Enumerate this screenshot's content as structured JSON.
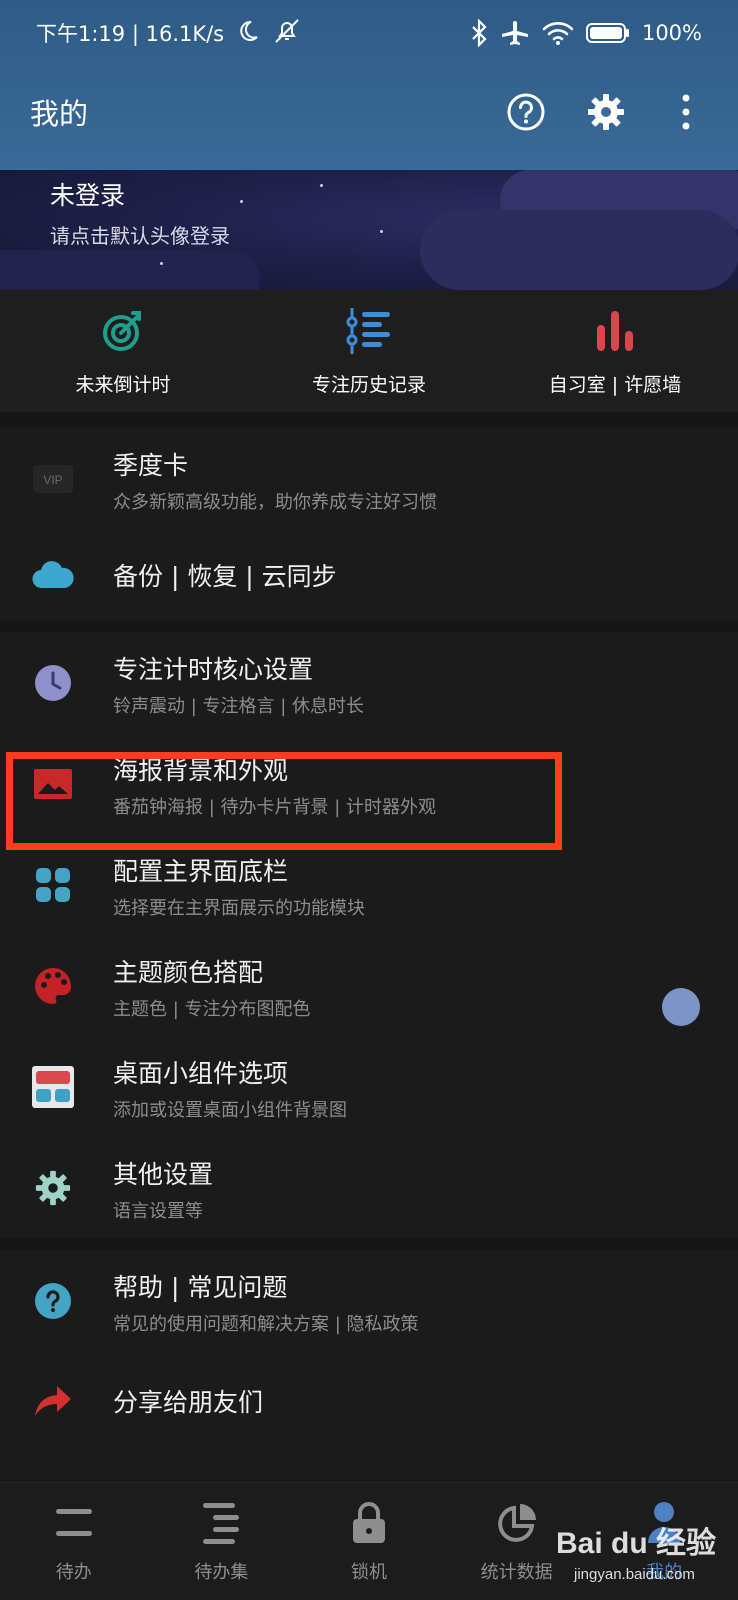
{
  "status_bar": {
    "time_speed": "下午1:19 | 16.1K/s",
    "battery": "100%"
  },
  "app_bar": {
    "title": "我的"
  },
  "profile": {
    "name": "未登录",
    "hint": "请点击默认头像登录"
  },
  "quick_actions": [
    {
      "label": "未来倒计时",
      "icon": "target-icon",
      "color": "#1e9e8c"
    },
    {
      "label": "专注历史记录",
      "icon": "timeline-list-icon",
      "color": "#3a8fd8"
    },
    {
      "label": "自习室 | 许愿墙",
      "icon": "bar-chart-icon",
      "color": "#d8474d"
    }
  ],
  "section1": [
    {
      "title": "季度卡",
      "subtitle": "众多新颖高级功能，助你养成专注好习惯",
      "icon": "vip-icon",
      "badge": "VIP"
    },
    {
      "title": "备份 | 恢复 | 云同步",
      "icon": "cloud-icon"
    }
  ],
  "section2": [
    {
      "title": "专注计时核心设置",
      "subtitle": "铃声震动 | 专注格言 | 休息时长",
      "icon": "clock-icon"
    },
    {
      "title": "海报背景和外观",
      "subtitle": "番茄钟海报 | 待办卡片背景 | 计时器外观",
      "icon": "image-icon"
    },
    {
      "title": "配置主界面底栏",
      "subtitle": "选择要在主界面展示的功能模块",
      "icon": "grid-icon"
    },
    {
      "title": "主题颜色搭配",
      "subtitle": "主题色 | 专注分布图配色",
      "icon": "palette-icon"
    },
    {
      "title": "桌面小组件选项",
      "subtitle": "添加或设置桌面小组件背景图",
      "icon": "widget-icon"
    },
    {
      "title": "其他设置",
      "subtitle": "语言设置等",
      "icon": "gear-icon"
    }
  ],
  "section3": [
    {
      "title": "帮助 | 常见问题",
      "subtitle": "常见的使用问题和解决方案 | 隐私政策",
      "icon": "help-icon"
    },
    {
      "title": "分享给朋友们",
      "icon": "share-icon"
    }
  ],
  "bottom_nav": [
    {
      "label": "待办",
      "icon": "todo-icon"
    },
    {
      "label": "待办集",
      "icon": "todo-set-icon"
    },
    {
      "label": "锁机",
      "icon": "lock-icon"
    },
    {
      "label": "统计数据",
      "icon": "pie-chart-icon"
    },
    {
      "label": "我的",
      "icon": "person-icon",
      "active": true
    }
  ],
  "watermark": {
    "brand": "Bai du 经验",
    "url": "jingyan.baidu.com"
  },
  "colors": {
    "header": "#3a6a98",
    "highlight": "#ff3c1e",
    "active_nav": "#4e80c4"
  }
}
